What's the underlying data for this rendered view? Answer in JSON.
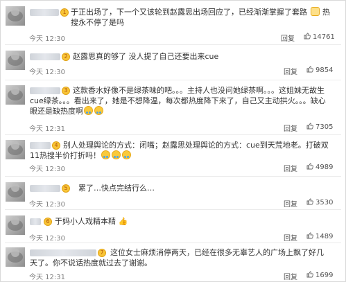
{
  "comments": [
    {
      "badge": "1",
      "text": "于正出场了，下一个又该轮到赵露思出场回应了，已经渐渐掌握了套路 ",
      "text_tail": " 热搜永不停了是吗",
      "time": "今天 12:30",
      "reply": "回复",
      "likes": "14761"
    },
    {
      "badge": "2",
      "text": "赵露思真的够了 没人提了自己还要出来cue",
      "time": "今天 12:30",
      "reply": "回复",
      "likes": "9854"
    },
    {
      "badge": "3",
      "text": "这款香水好像不是绿茶味的吧。。。主持人也没问她绿茶啊。。。这姐妹无故生cue绿茶。。。看出来了，她是不想降温，每次都热度降下来了，自己又主动拱火。。。缺心眼还是缺热度啊",
      "time": "今天 12:31",
      "reply": "回复",
      "likes": "7305"
    },
    {
      "badge": "4",
      "text": "别人处理舆论的方式：闭嘴；赵露思处理舆论的方式：cue到天荒地老。打破双11热搜半价打折吗！",
      "time": "今天 12:30",
      "reply": "回复",
      "likes": "4989"
    },
    {
      "badge": "5",
      "text": "累了…快点完结行么…",
      "time": "今天 12:30",
      "reply": "回复",
      "likes": "3530"
    },
    {
      "badge": "6",
      "text": "于妈小人戏精本精",
      "time": "今天 12:30",
      "reply": "回复",
      "likes": "1489"
    },
    {
      "badge": "7",
      "text": "这位女士麻烦消停两天，已经在很多无辜艺人的广场上飘了好几天了。你不说话热度就过去了谢谢。",
      "time": "今天 12:31",
      "reply": "回复",
      "likes": "1699"
    }
  ],
  "icons": {
    "like": "thumbs-up-icon",
    "reaction": "emoji-icon",
    "level": "member-badge-icon"
  },
  "colors": {
    "text": "#333333",
    "meta": "#808080",
    "badge": "#f8c437"
  }
}
